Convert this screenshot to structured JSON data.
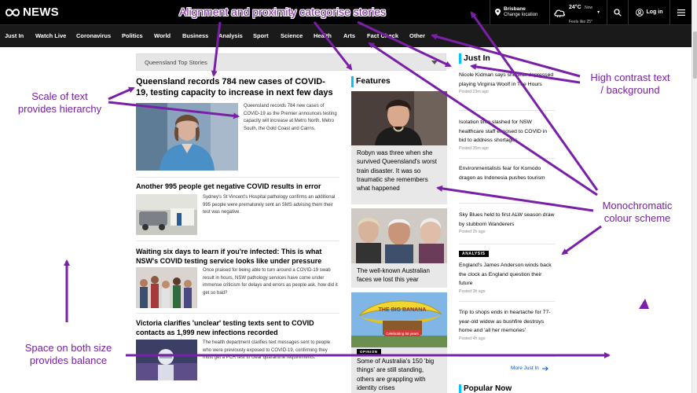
{
  "header": {
    "logo_text": "NEWS",
    "location": {
      "city": "Brisbane",
      "change_label": "Change location"
    },
    "weather": {
      "temp": "24°C",
      "now_label": "Now",
      "feels_like": "Feels like 25°"
    },
    "login_label": "Log in",
    "icons": [
      "abc-logo-icon",
      "location-pin-icon",
      "weather-cloud-icon",
      "chevron-down-icon",
      "search-icon",
      "user-icon",
      "hamburger-menu-icon"
    ]
  },
  "nav": {
    "items": [
      "Just In",
      "Watch Live",
      "Coronavirus",
      "Politics",
      "World",
      "Business",
      "Analysis",
      "Sport",
      "Science",
      "Health",
      "Arts",
      "Fact Check",
      "Other"
    ]
  },
  "main": {
    "dropdown_label": "Queensland Top Stories",
    "lead": {
      "title": "Queensland records 784 new cases of COVID-19, testing capacity to increase in next few days",
      "summary": "Queensland records 784 new cases of COVID-19 as the Premier announces testing capacity will increase at Metro North, Metro South, the Gold Coast and Cairns."
    },
    "stories": [
      {
        "title": "Another 995 people get negative COVID results in error",
        "summary": "Sydney's St Vincent's Hospital pathology confirms an additional 995 people were prematurely sent an SMS advising them their test was negative."
      },
      {
        "title": "Waiting six days to learn if you're infected: This is what NSW's COVID testing service looks like under pressure",
        "summary": "Once praised for being able to turn around a COVID-19 swab result in hours, NSW pathology services have come under immense criticism for delays and errors as people ask, how did it get so bad?"
      },
      {
        "title": "Victoria clarifies 'unclear' testing texts sent to COVID contacts as 1,999 new infections recorded",
        "summary": "The health department clarifies text messages sent to people who were previously exposed to COVID-19, confirming they must get a PCR test to clear quarantine requirements."
      }
    ]
  },
  "features": {
    "heading": "Features",
    "cards": [
      {
        "text": "Robyn was three when she survived Queensland's worst train disaster. It was so traumatic she remembers what happened"
      },
      {
        "text": "The well-known Australian faces we lost this year"
      },
      {
        "tag": "OPINION",
        "text": "Some of Australia's 150 'big things' are still standing, others are grappling with identity crises"
      }
    ],
    "banana_sign": "THE BIG BANANA",
    "banana_banner": "Celebrating 56 years"
  },
  "just_in": {
    "heading": "Just In",
    "items": [
      {
        "title": "Nicole Kidman says she was depressed playing Virginia Woolf in The Hours",
        "time": "Posted 23m ago"
      },
      {
        "title": "Isolation time slashed for NSW healthcare staff exposed to COVID in bid to address shortages",
        "time": "Posted 35m ago"
      },
      {
        "title": "Environmentalists fear for Komodo dragon as Indonesia pushes tourism",
        "time": ""
      },
      {
        "title": "Sky Blues held to first ALW season draw by stubborn Wanderers",
        "time": "Posted 2h ago"
      },
      {
        "tag": "ANALYSIS",
        "title": "England's James Anderson winds back the clock as England question their future",
        "time": "Posted 3h ago"
      },
      {
        "title": "Trip to shops ends in heartache for 77-year-old widow as bushfire destroys home and 'all her memories'",
        "time": "Posted 4h ago"
      }
    ],
    "more_label": "More Just In",
    "popular_heading": "Popular Now"
  },
  "annotations": {
    "alignment": "Alignment and proximity categorise stories",
    "scale": [
      "Scale of text",
      "provides hierarchy"
    ],
    "contrast": [
      "High contrast text",
      "/ background"
    ],
    "mono": [
      "Monochromatic",
      "colour scheme"
    ],
    "space": [
      "Space on both size",
      "provides balance"
    ],
    "color": "#7a1fa8"
  },
  "colors": {
    "header_bg": "#000000",
    "nav_bg": "#1a1a1a",
    "accent": "#00c4ff",
    "link": "#0058cc",
    "annotation": "#7a1fa8"
  }
}
